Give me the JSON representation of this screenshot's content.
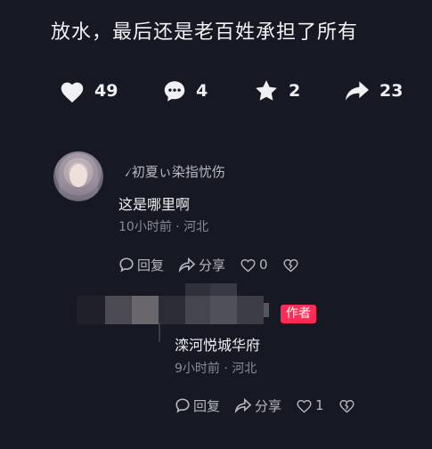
{
  "caption": "放水，最后还是老百姓承担了所有",
  "actions": {
    "like_count": "49",
    "comment_count": "4",
    "favorite_count": "2",
    "share_count": "23"
  },
  "comment": {
    "username": "৴初夏ぃ染指忧伤",
    "text": "这是哪里啊",
    "meta": "10小时前 · 河北",
    "reply_label": "回复",
    "share_label": "分享",
    "like_count": "0"
  },
  "reply": {
    "badge": "作者",
    "text": "滦河悦城华府",
    "meta": "9小时前 · 河北",
    "reply_label": "回复",
    "share_label": "分享",
    "like_count": "1"
  },
  "colors": {
    "background": "#161823",
    "author_badge": "#fe2c55",
    "text_primary": "#f0f0f2",
    "text_secondary": "#8a8b93"
  }
}
